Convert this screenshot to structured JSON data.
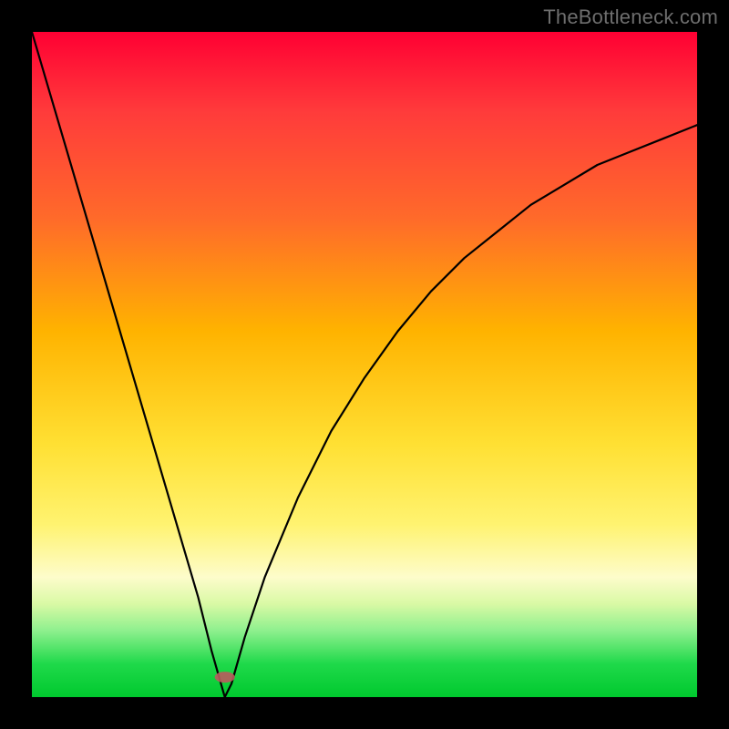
{
  "watermark": "TheBottleneck.com",
  "chart_data": {
    "type": "line",
    "title": "",
    "xlabel": "",
    "ylabel": "",
    "xlim": [
      0,
      100
    ],
    "ylim": [
      0,
      100
    ],
    "note": "V-shaped bottleneck curve. Minimum (optimal point) near x≈29, y≈0. Left branch nearly linear rising to (0,100). Right branch concave rising, asymptoting toward ~86 at x=100.",
    "series": [
      {
        "name": "bottleneck-curve",
        "x": [
          0,
          5,
          10,
          15,
          20,
          25,
          27,
          29,
          30,
          32,
          35,
          40,
          45,
          50,
          55,
          60,
          65,
          70,
          75,
          80,
          85,
          90,
          95,
          100
        ],
        "values": [
          100,
          83,
          66,
          49,
          32,
          15,
          7,
          0,
          2,
          9,
          18,
          30,
          40,
          48,
          55,
          61,
          66,
          70,
          74,
          77,
          80,
          82,
          84,
          86
        ]
      }
    ],
    "marker": {
      "x": 29,
      "y": 3,
      "color": "#bb5a5e"
    }
  }
}
